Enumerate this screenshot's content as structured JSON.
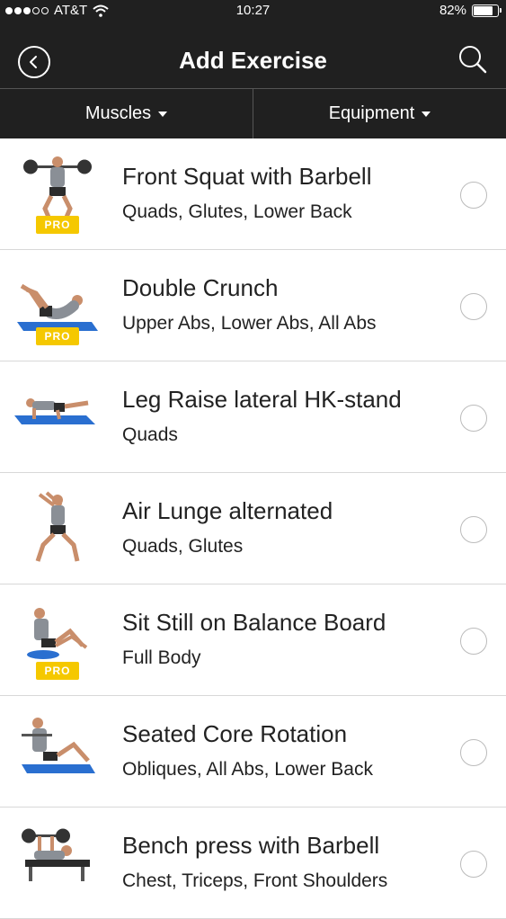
{
  "status_bar": {
    "carrier": "AT&T",
    "time": "10:27",
    "battery": "82%",
    "battery_level": 0.82
  },
  "nav": {
    "title": "Add Exercise"
  },
  "filters": {
    "muscles": "Muscles",
    "equipment": "Equipment"
  },
  "exercises": [
    {
      "name": "Front Squat with Barbell",
      "muscles": "Quads, Glutes, Lower Back",
      "pro": "PRO"
    },
    {
      "name": "Double Crunch",
      "muscles": "Upper Abs, Lower Abs, All Abs",
      "pro": "PRO"
    },
    {
      "name": "Leg Raise lateral HK-stand",
      "muscles": "Quads",
      "pro": ""
    },
    {
      "name": "Air Lunge alternated",
      "muscles": "Quads, Glutes",
      "pro": ""
    },
    {
      "name": "Sit Still on Balance Board",
      "muscles": "Full Body",
      "pro": "PRO"
    },
    {
      "name": "Seated Core Rotation",
      "muscles": "Obliques, All Abs, Lower Back",
      "pro": ""
    },
    {
      "name": "Bench press with Barbell",
      "muscles": "Chest, Triceps, Front Shoulders",
      "pro": ""
    }
  ],
  "colors": {
    "header_bg": "#202020",
    "pro_badge": "#f5c800",
    "mat_blue": "#2a6fd0"
  }
}
